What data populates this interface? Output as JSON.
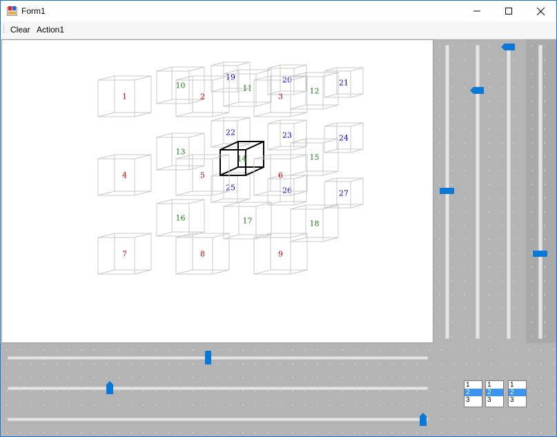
{
  "window": {
    "title": "Form1",
    "minimize_symbol": "—",
    "maximize_symbol": "☐",
    "close_symbol": "✕"
  },
  "menu": {
    "items": [
      "Clear",
      "Action1"
    ]
  },
  "cubes": {
    "labels": [
      "1",
      "2",
      "3",
      "4",
      "5",
      "6",
      "7",
      "8",
      "9",
      "10",
      "11",
      "12",
      "13",
      "14",
      "15",
      "16",
      "17",
      "18",
      "19",
      "20",
      "21",
      "22",
      "23",
      "24",
      "25",
      "26",
      "27"
    ],
    "colors": {
      "front": "#cc0000",
      "middle": "#1a7a1a",
      "back": "#0000cc"
    },
    "selected": "14"
  },
  "sliders": {
    "vertical_1": 0.5,
    "vertical_2": 0.85,
    "vertical_3": 1.0,
    "vertical_4": 0.28,
    "horizontal_1": 0.48,
    "horizontal_2": 0.24,
    "horizontal_3": 1.0
  },
  "listboxes": [
    {
      "items": [
        "1",
        "2",
        "3"
      ],
      "selected": 1
    },
    {
      "items": [
        "1",
        "2",
        "3"
      ],
      "selected": 1
    },
    {
      "items": [
        "1",
        "2",
        "3"
      ],
      "selected": 1
    }
  ]
}
